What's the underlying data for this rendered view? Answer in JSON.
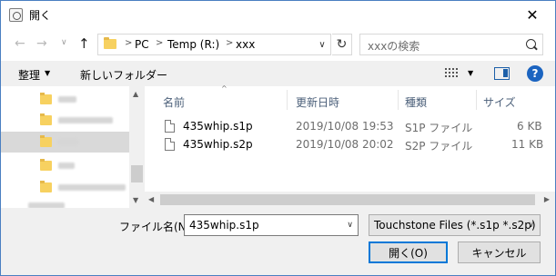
{
  "window": {
    "title": "開く"
  },
  "nav": {
    "back_glyph": "←",
    "forward_glyph": "→",
    "recent_glyph": "∨",
    "up_glyph": "↑",
    "breadcrumb": [
      "PC",
      "Temp (R:)",
      "xxx"
    ],
    "breadcrumb_sep": ">",
    "dropdown_glyph": "∨",
    "refresh_glyph": "↻",
    "search_placeholder": "xxxの検索"
  },
  "toolbar": {
    "organize_label": "整理",
    "new_folder_label": "新しいフォルダー",
    "dropdown_glyph": "▼",
    "help_glyph": "?"
  },
  "sidebar": {
    "selected_index": 2,
    "scroll_up_glyph": "▲",
    "scroll_down_glyph": "▼"
  },
  "filelist": {
    "sort_glyph": "^",
    "columns": [
      "名前",
      "更新日時",
      "種類",
      "サイズ"
    ],
    "rows": [
      {
        "name": "435whip.s1p",
        "modified": "2019/10/08 19:53",
        "type": "S1P ファイル",
        "size": "6 KB"
      },
      {
        "name": "435whip.s2p",
        "modified": "2019/10/08 20:02",
        "type": "S2P ファイル",
        "size": "11 KB"
      }
    ],
    "scroll_left_glyph": "◀",
    "scroll_right_glyph": "▶"
  },
  "bottom": {
    "filename_label": "ファイル名(N):",
    "filename_value": "435whip.s1p",
    "dropdown_glyph": "∨",
    "filetype_value": "Touchstone Files (*.s1p *.s2p)",
    "open_label": "開く(O)",
    "cancel_label": "キャンセル"
  },
  "colors": {
    "accent": "#0078d7",
    "header_text": "#4c607a",
    "selection": "#d9d9d9",
    "folder": "#f7d160"
  },
  "icons": {
    "app": "dialog-app-icon",
    "close": "close-icon",
    "folder": "folder-icon",
    "file": "file-icon",
    "search": "search-icon",
    "view": "view-options-icon",
    "preview": "preview-pane-icon",
    "help": "help-icon"
  }
}
